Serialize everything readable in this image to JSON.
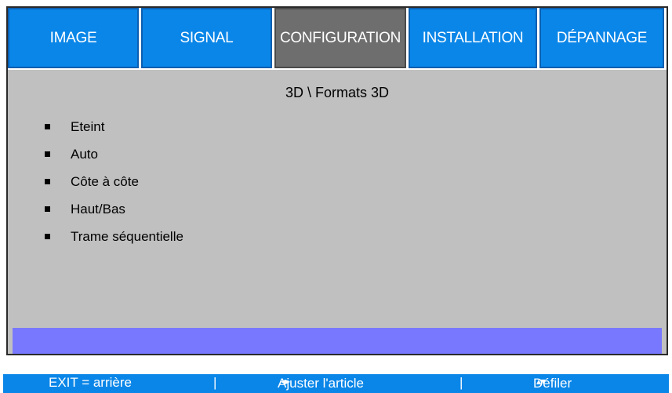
{
  "tabs": [
    {
      "label": "IMAGE",
      "active": false
    },
    {
      "label": "SIGNAL",
      "active": false
    },
    {
      "label": "CONFIGURATION",
      "active": true
    },
    {
      "label": "INSTALLATION",
      "active": false
    },
    {
      "label": "DÉPANNAGE",
      "active": false
    }
  ],
  "breadcrumb": "3D \\ Formats 3D",
  "options": [
    "Eteint",
    "Auto",
    "Côte à côte",
    "Haut/Bas",
    "Trame séquentielle"
  ],
  "footer": {
    "exit": "EXIT = arrière",
    "separator": "|",
    "adjust": "Ajuster l'article",
    "adjust_arrows": "◂▸",
    "scroll": "Défiler",
    "scroll_arrows": "▴▾"
  },
  "colors": {
    "tab_blue": "#0a86e8",
    "tab_active": "#6e6e6e",
    "panel": "#c0c0c0",
    "highlight": "#7878ff"
  }
}
